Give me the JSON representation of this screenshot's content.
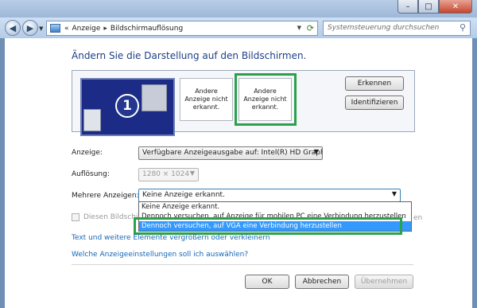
{
  "window": {
    "minimize_symbol": "–",
    "maximize_symbol": "□",
    "close_symbol": "✕"
  },
  "navbar": {
    "back_symbol": "◀",
    "forward_symbol": "▶",
    "address_chevron": "«",
    "breadcrumb": [
      "Anzeige",
      "Bildschirmauflösung"
    ],
    "breadcrumb_sep": "▸",
    "search_placeholder": "Systemsteuerung durchsuchen"
  },
  "main": {
    "heading": "Ändern Sie die Darstellung auf den Bildschirmen.",
    "monitors": {
      "primary_number": "1",
      "undetected_1": "Andere Anzeige nicht erkannt.",
      "undetected_2": "Andere Anzeige nicht erkannt."
    },
    "buttons": {
      "detect": "Erkennen",
      "identify": "Identifizieren"
    },
    "display_label": "Anzeige:",
    "display_value": "Verfügbare Anzeigeausgabe auf: Intel(R) HD Graphics",
    "resolution_label": "Auflösung:",
    "resolution_value": "1280 × 1024",
    "multiple_label": "Mehrere Anzeigen:",
    "multiple_value": "Keine Anzeige erkannt.",
    "multiple_options": [
      "Keine Anzeige erkannt.",
      "Dennoch versuchen, auf Anzeige für mobilen PC eine Verbindung herzustellen",
      "Dennoch versuchen, auf VGA eine Verbindung herzustellen"
    ],
    "selected_option_index": 2,
    "checkbox_label": "Diesen Bildschirm",
    "checkbox_cutoff": "en",
    "link_text_size": "Text und weitere Elemente vergrößern oder verkleinern",
    "link_which_settings": "Welche Anzeigeeinstellungen soll ich auswählen?"
  },
  "footer": {
    "ok": "OK",
    "cancel": "Abbrechen",
    "apply": "Übernehmen"
  },
  "colors": {
    "heading": "#1e3f87",
    "link": "#1667b8",
    "highlight_box": "#2aa14a",
    "selection": "#3399ff"
  }
}
